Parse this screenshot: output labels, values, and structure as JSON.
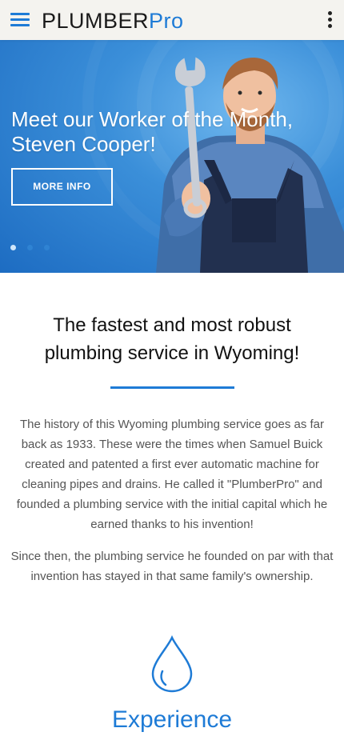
{
  "header": {
    "logo_part1": "PLUMBER",
    "logo_part2": "Pro",
    "menu_icon": "hamburger-icon",
    "more_icon": "vertical-dots-icon"
  },
  "hero": {
    "title": "Meet our Worker of the Month, Steven Cooper!",
    "button_label": "MORE INFO",
    "slides": 3,
    "active_slide": 1
  },
  "content": {
    "headline": "The fastest and most robust plumbing service in Wyoming!",
    "paragraph1": "The history of this Wyoming plumbing service goes as far back as 1933. These were the times when Samuel Buick created and patented a first ever automatic machine for cleaning pipes and drains. He called it \"PlumberPro\" and founded a plumbing service with the initial capital which he earned thanks to his invention!",
    "paragraph2": "Since then, the plumbing service he founded on par with that invention has stayed in that same family's ownership.",
    "feature_icon": "water-drop-icon",
    "feature_title": "Experience"
  },
  "colors": {
    "accent": "#1e7bd6",
    "header_bg": "#f4f3ef",
    "hero_bg": "#3b8fd9"
  }
}
